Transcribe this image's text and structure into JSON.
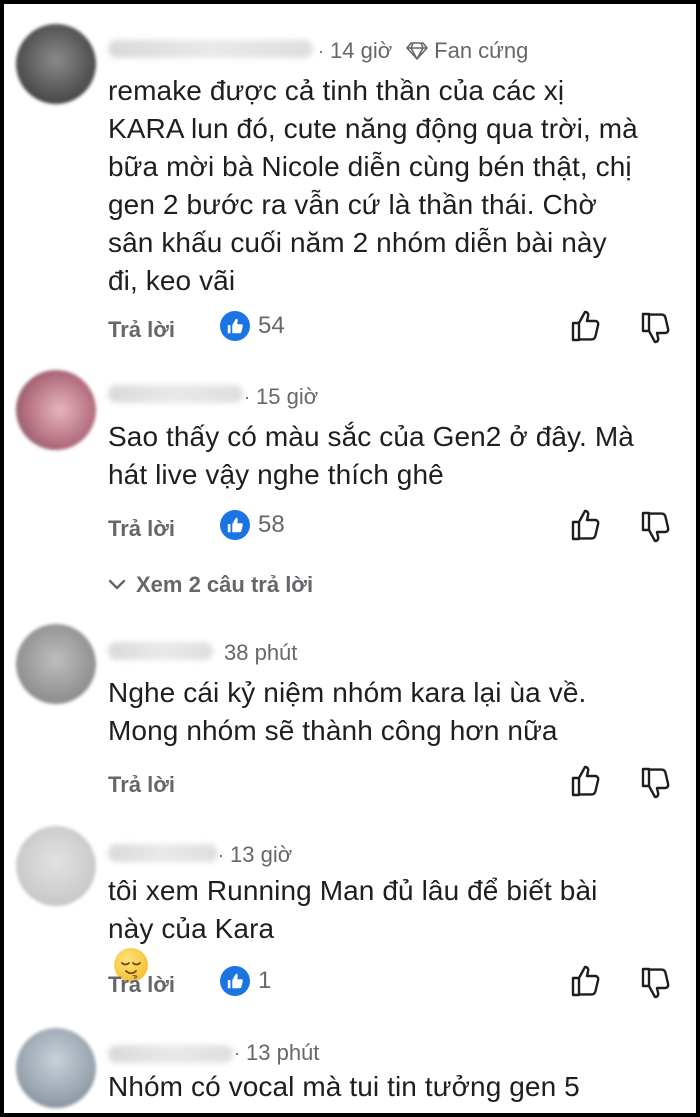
{
  "reply_label": "Trả lời",
  "view_replies_label": "Xem 2 câu trả lời",
  "comments": [
    {
      "time": "14 giờ",
      "badge": "Fan cứng",
      "lines": [
        "remake được cả tinh thần của các xị",
        "KARA lun đó, cute năng động qua trời, mà",
        "bữa mời bà Nicole diễn cùng bén thật, chị",
        "gen 2 bước ra vẫn cứ là thần thái. Chờ",
        "sân khấu cuối năm 2 nhóm diễn bài này",
        "đi, keo vãi"
      ],
      "likes": "54"
    },
    {
      "time": "15 giờ",
      "lines": [
        "Sao thấy có màu sắc của Gen2 ở đây. Mà",
        "hát live vậy nghe thích ghê"
      ],
      "likes": "58"
    },
    {
      "time": "38 phút",
      "lines": [
        "Nghe cái kỷ niệm nhóm kara lại ùa về.",
        "Mong nhóm sẽ thành công hơn nữa"
      ]
    },
    {
      "time": "13 giờ",
      "lines": [
        "tôi xem Running Man đủ lâu để biết bài",
        "này của Kara"
      ],
      "emoji": "relieved-face",
      "likes": "1"
    },
    {
      "time": "13 phút",
      "lines": [
        "Nhóm có vocal mà tui tin tưởng gen 5"
      ]
    }
  ],
  "colors": {
    "text": "#1c1e21",
    "meta": "#65676b",
    "like_blue": "#1b74e4"
  },
  "icons": [
    "diamond-icon",
    "like-reaction-icon",
    "thumb-up-icon",
    "thumb-down-icon",
    "chevron-down-icon",
    "relieved-face-emoji"
  ]
}
